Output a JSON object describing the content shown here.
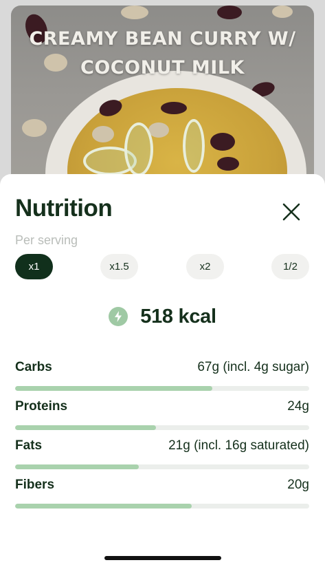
{
  "recipe": {
    "title_line1": "CREAMY BEAN CURRY W/",
    "title_line2": "COCONUT MILK"
  },
  "sheet": {
    "title": "Nutrition",
    "subtitle": "Per serving",
    "close_icon": "close-icon"
  },
  "portions": [
    {
      "label": "x1",
      "selected": true
    },
    {
      "label": "x1.5",
      "selected": false
    },
    {
      "label": "x2",
      "selected": false
    },
    {
      "label": "1/2",
      "selected": false
    }
  ],
  "energy": {
    "icon": "lightning-bolt-icon",
    "value": "518 kcal"
  },
  "nutrients": [
    {
      "name": "Carbs",
      "amount": "67g (incl. 4g sugar)",
      "fill_fraction": 0.67
    },
    {
      "name": "Proteins",
      "amount": "24g",
      "fill_fraction": 0.48
    },
    {
      "name": "Fats",
      "amount": "21g (incl. 16g saturated)",
      "fill_fraction": 0.42
    },
    {
      "name": "Fibers",
      "amount": "20g",
      "fill_fraction": 0.6
    }
  ],
  "colors": {
    "accent_dark": "#11301c",
    "bar_fill": "#a9d2ad",
    "bar_track": "#ebeeeb",
    "bolt_badge": "#9fc9a4"
  }
}
